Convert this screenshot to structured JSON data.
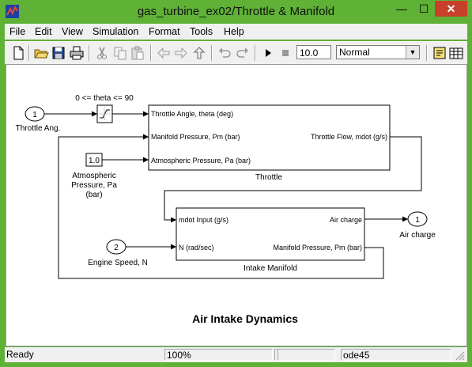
{
  "window": {
    "title": "gas_turbine_ex02/Throttle & Manifold",
    "minimize_glyph": "—",
    "maximize_glyph": "☐",
    "close_glyph": "✕"
  },
  "menu": [
    "File",
    "Edit",
    "View",
    "Simulation",
    "Format",
    "Tools",
    "Help"
  ],
  "toolbar": {
    "stop_time": "10.0",
    "sim_mode": "Normal",
    "icons": [
      "new-icon",
      "open-icon",
      "save-icon",
      "print-icon",
      "cut-icon",
      "copy-icon",
      "paste-icon",
      "back-icon",
      "forward-icon",
      "up-icon",
      "undo-icon",
      "redo-icon",
      "play-icon",
      "stop-icon",
      "library-browser-icon",
      "model-explorer-icon"
    ]
  },
  "diagram": {
    "inport1_num": "1",
    "inport1_label": "Throttle Ang.",
    "saturation_label": "0 <= theta <= 90",
    "const_value": "1.0",
    "const_label_1": "Atmospheric",
    "const_label_2": "Pressure, Pa",
    "const_label_3": "(bar)",
    "throttle_in1": "Throttle Angle, theta (deg)",
    "throttle_in2": "Manifold Pressure, Pm (bar)",
    "throttle_in3": "Atmospheric Pressure, Pa (bar)",
    "throttle_out": "Throttle  Flow, mdot  (g/s)",
    "throttle_name": "Throttle",
    "inport2_num": "2",
    "inport2_label": "Engine Speed, N",
    "manifold_in1": "mdot Input  (g/s)",
    "manifold_in2": "N (rad/sec)",
    "manifold_out1": "Air charge",
    "manifold_out2": "Manifold Pressure, Pm (bar)",
    "manifold_name": "Intake Manifold",
    "outport1_num": "1",
    "outport1_label": "Air charge",
    "annotation": "Air Intake Dynamics"
  },
  "status": {
    "state": "Ready",
    "zoom": "100%",
    "field3": "",
    "field4": "",
    "solver": "ode45"
  },
  "colors": {
    "title_bar": "#5fb236",
    "close_button": "#c7402c"
  }
}
